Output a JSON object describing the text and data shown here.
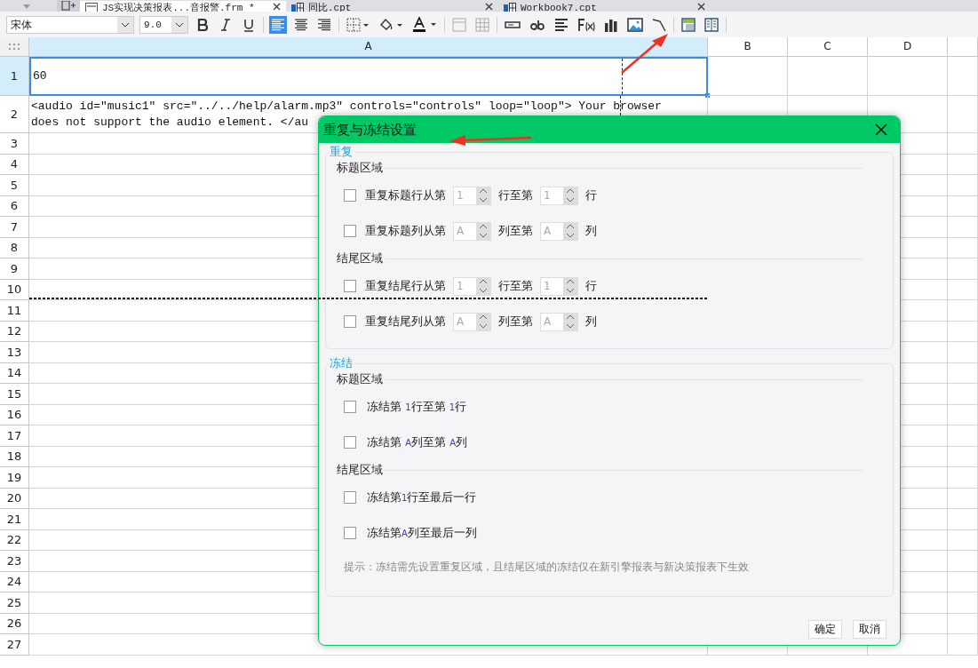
{
  "tabs": [
    {
      "label": "JS实现决策报表...音报警.frm *",
      "selected": true,
      "kind": "form"
    },
    {
      "label": "同比.cpt",
      "selected": false,
      "kind": "workbook"
    },
    {
      "label": "Workbook7.cpt",
      "selected": false,
      "kind": "workbook"
    }
  ],
  "toolbar": {
    "font": "宋体",
    "size": "9.0",
    "align": [
      {
        "selected": true
      },
      {
        "selected": false
      },
      {
        "selected": false
      }
    ]
  },
  "sheet": {
    "columns": [
      "A",
      "B",
      "C",
      "D"
    ],
    "rows": [
      {
        "label": "1",
        "kind": "tall",
        "lines": [
          "60"
        ],
        "selected": true,
        "page_break": false
      },
      {
        "label": "2",
        "kind": "tall",
        "lines": [
          "<audio id=\"music1\" src=\"../../help/alarm.mp3\" controls=\"controls\"  loop=\"loop\"> Your browser",
          "does not support the audio element. </au"
        ],
        "selected": false,
        "page_break": false
      },
      {
        "label": "3",
        "kind": "normal",
        "selected": false,
        "page_break": false
      },
      {
        "label": "4",
        "kind": "normal",
        "selected": false,
        "page_break": false
      },
      {
        "label": "5",
        "kind": "normal",
        "selected": false,
        "page_break": false
      },
      {
        "label": "6",
        "kind": "normal",
        "selected": false,
        "page_break": false
      },
      {
        "label": "7",
        "kind": "normal",
        "selected": false,
        "page_break": false
      },
      {
        "label": "8",
        "kind": "normal",
        "selected": false,
        "page_break": false
      },
      {
        "label": "9",
        "kind": "normal",
        "selected": false,
        "page_break": false
      },
      {
        "label": "10",
        "kind": "normal",
        "selected": false,
        "page_break": true
      },
      {
        "label": "11",
        "kind": "normal",
        "selected": false,
        "page_break": false
      },
      {
        "label": "12",
        "kind": "normal",
        "selected": false,
        "page_break": false
      },
      {
        "label": "13",
        "kind": "normal",
        "selected": false,
        "page_break": false
      },
      {
        "label": "14",
        "kind": "normal",
        "selected": false,
        "page_break": false
      },
      {
        "label": "15",
        "kind": "normal",
        "selected": false,
        "page_break": false
      },
      {
        "label": "16",
        "kind": "normal",
        "selected": false,
        "page_break": false
      },
      {
        "label": "17",
        "kind": "normal",
        "selected": false,
        "page_break": false
      },
      {
        "label": "18",
        "kind": "normal",
        "selected": false,
        "page_break": false
      },
      {
        "label": "19",
        "kind": "normal",
        "selected": false,
        "page_break": false
      },
      {
        "label": "20",
        "kind": "normal",
        "selected": false,
        "page_break": false
      },
      {
        "label": "21",
        "kind": "normal",
        "selected": false,
        "page_break": false
      },
      {
        "label": "22",
        "kind": "normal",
        "selected": false,
        "page_break": false
      },
      {
        "label": "23",
        "kind": "normal",
        "selected": false,
        "page_break": false
      },
      {
        "label": "24",
        "kind": "normal",
        "selected": false,
        "page_break": false
      },
      {
        "label": "25",
        "kind": "normal",
        "selected": false,
        "page_break": false
      },
      {
        "label": "26",
        "kind": "normal",
        "selected": false,
        "page_break": false
      },
      {
        "label": "27",
        "kind": "normal",
        "selected": false,
        "page_break": false
      }
    ]
  },
  "dialog": {
    "title": "重复与冻结设置",
    "repeat": {
      "legend": "重复",
      "groups": [
        {
          "heading": "标题区域",
          "rows": [
            {
              "checked": false,
              "label": "重复标题行从第",
              "from": {
                "value": "1",
                "disabled": true
              },
              "middle": "行至第",
              "to": {
                "value": "1",
                "disabled": true
              },
              "unit": "行"
            },
            {
              "checked": false,
              "label": "重复标题列从第",
              "from": {
                "value": "A",
                "disabled": true
              },
              "middle": "列至第",
              "to": {
                "value": "A",
                "disabled": true
              },
              "unit": "列"
            }
          ]
        },
        {
          "heading": "结尾区域",
          "rows": [
            {
              "checked": false,
              "label": "重复结尾行从第",
              "from": {
                "value": "1",
                "disabled": true
              },
              "middle": "行至第",
              "to": {
                "value": "1",
                "disabled": true
              },
              "unit": "行"
            },
            {
              "checked": false,
              "label": "重复结尾列从第",
              "from": {
                "value": "A",
                "disabled": true
              },
              "middle": "列至第",
              "to": {
                "value": "A",
                "disabled": true
              },
              "unit": "列"
            }
          ]
        }
      ]
    },
    "freeze": {
      "legend": "冻结",
      "groups": [
        {
          "heading": "标题区域",
          "rows": [
            {
              "checked": false,
              "parts": [
                "冻结第 ",
                "1",
                "行至第  ",
                "1",
                "行"
              ]
            },
            {
              "checked": false,
              "parts": [
                "冻结第 ",
                "A",
                "列至第  ",
                "A",
                "列"
              ]
            }
          ]
        },
        {
          "heading": "结尾区域",
          "rows": [
            {
              "checked": false,
              "parts": [
                "冻结第",
                "1",
                "行至最后一行"
              ]
            },
            {
              "checked": false,
              "parts": [
                "冻结第",
                "A",
                "列至最后一列"
              ]
            }
          ]
        }
      ],
      "hint": "提示：冻结需先设置重复区域，且结尾区域的冻结仅在新引擎报表与新决策报表下生效"
    },
    "buttons": [
      "确定",
      "取消"
    ]
  }
}
